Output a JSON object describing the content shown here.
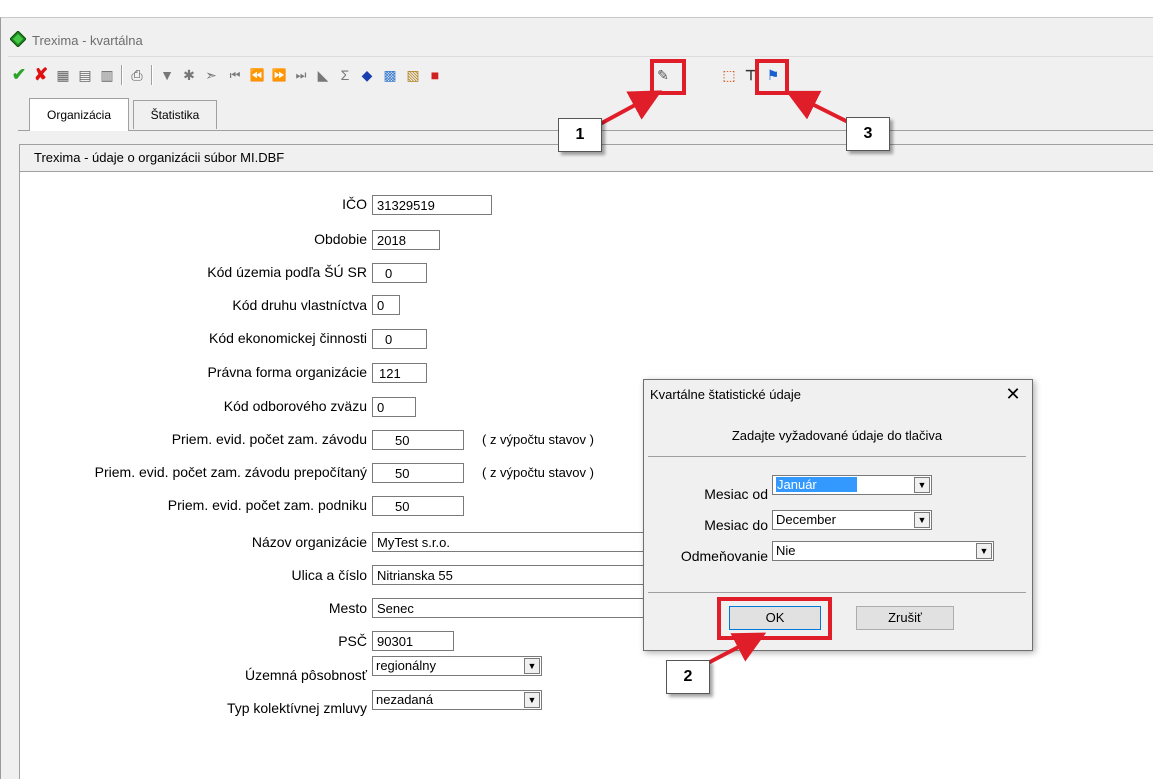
{
  "window": {
    "title": "Trexima - kvartálna"
  },
  "toolbar": {
    "icons": [
      "check-icon",
      "cross-icon",
      "grid-icon",
      "grid2-icon",
      "building-icon",
      "print-icon",
      "filter-icon",
      "filter-clear-icon",
      "filter-run-icon",
      "first-icon",
      "prev-icon",
      "next-icon",
      "last-icon",
      "stamp-icon",
      "sigma-icon",
      "cube-icon",
      "table-icon",
      "chart-icon",
      "color-icon",
      "brush-icon",
      "export-icon",
      "tool-icon",
      "run-icon"
    ]
  },
  "tabs": [
    {
      "label": "Organizácia"
    },
    {
      "label": "Štatistika"
    }
  ],
  "panel": {
    "header": "Trexima - údaje o organizácii súbor MI.DBF"
  },
  "form": {
    "ico": {
      "label": "IČO",
      "value": "31329519"
    },
    "obdobie": {
      "label": "Obdobie",
      "value": "2018"
    },
    "kod_uzemia": {
      "label": "Kód územia podľa ŠÚ SR",
      "value": "0"
    },
    "kod_druhu": {
      "label": "Kód druhu vlastníctva",
      "value": "0"
    },
    "kod_ekon": {
      "label": "Kód ekonomickej činnosti",
      "value": "0"
    },
    "pravna_forma": {
      "label": "Právna forma organizácie",
      "value": "121"
    },
    "kod_odbor": {
      "label": "Kód odborového zväzu",
      "value": "0"
    },
    "priem_zavod": {
      "label": "Priem. evid. počet zam. závodu",
      "value": "50",
      "note": "( z výpočtu stavov )"
    },
    "priem_prep": {
      "label": "Priem. evid. počet zam. závodu prepočítaný",
      "value": "50",
      "note": "( z výpočtu stavov )"
    },
    "priem_podnik": {
      "label": "Priem. evid. počet zam. podniku",
      "value": "50"
    },
    "nazov": {
      "label": "Názov organizácie",
      "value": "MyTest s.r.o."
    },
    "ulica": {
      "label": "Ulica a číslo",
      "value": "Nitrianska 55"
    },
    "mesto": {
      "label": "Mesto",
      "value": "Senec"
    },
    "psc": {
      "label": "PSČ",
      "value": "90301"
    },
    "uzemna": {
      "label": "Územná pôsobnosť",
      "value": "regionálny"
    },
    "typ_kz": {
      "label": "Typ kolektívnej zmluvy",
      "value": "nezadaná"
    }
  },
  "dialog": {
    "title": "Kvartálne štatistické údaje",
    "prompt": "Zadajte vyžadované údaje do tlačiva",
    "mesiac_od": {
      "label": "Mesiac od",
      "value": "Január"
    },
    "mesiac_do": {
      "label": "Mesiac do",
      "value": "December"
    },
    "odmenovanie": {
      "label": "Odmeňovanie",
      "value": "Nie"
    },
    "ok": "OK",
    "cancel": "Zrušiť"
  },
  "callouts": {
    "c1": "1",
    "c2": "2",
    "c3": "3"
  },
  "colors": {
    "highlight": "#e01e2a",
    "selection": "#3399ff"
  }
}
